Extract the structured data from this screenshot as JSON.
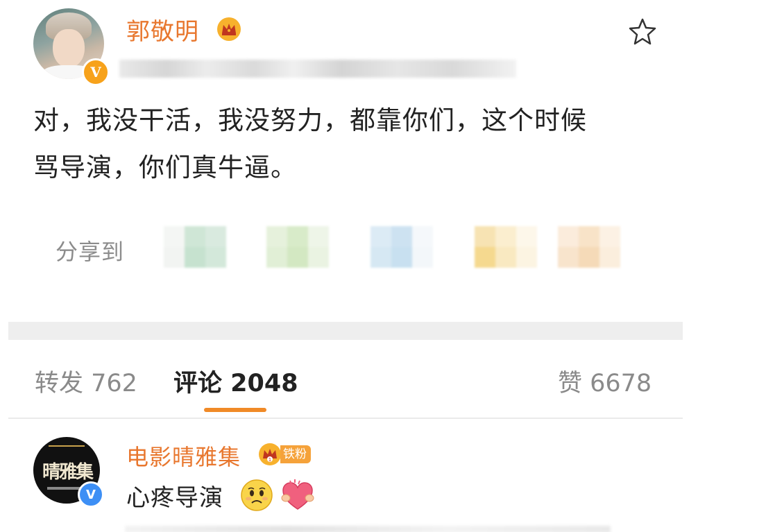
{
  "post": {
    "username": "郭敬明",
    "verified_icon": "orange-v-badge",
    "level_icon": "crown-icon",
    "text_line1": "对，我没干活，我没努力，都靠你们，这个时候",
    "text_line2": "骂导演，你们真牛逼。",
    "share_label": "分享到"
  },
  "tabs": {
    "repost": "转发 762",
    "comment": "评论 2048",
    "like": "赞 6678",
    "active": "comment",
    "active_color": "#f08a27"
  },
  "comment": {
    "username": "电影晴雅集",
    "avatar_text": "晴雅集",
    "fan_badge": "铁粉",
    "text": "心疼导演",
    "verified_icon": "blue-v-badge",
    "emojis": [
      "sad-face-icon",
      "hug-heart-icon"
    ]
  },
  "colors": {
    "username": "#e8772e",
    "badge_orange": "#f7a21b",
    "badge_blue": "#3d8ff5",
    "text": "#222222",
    "muted": "#8c8c8c"
  }
}
